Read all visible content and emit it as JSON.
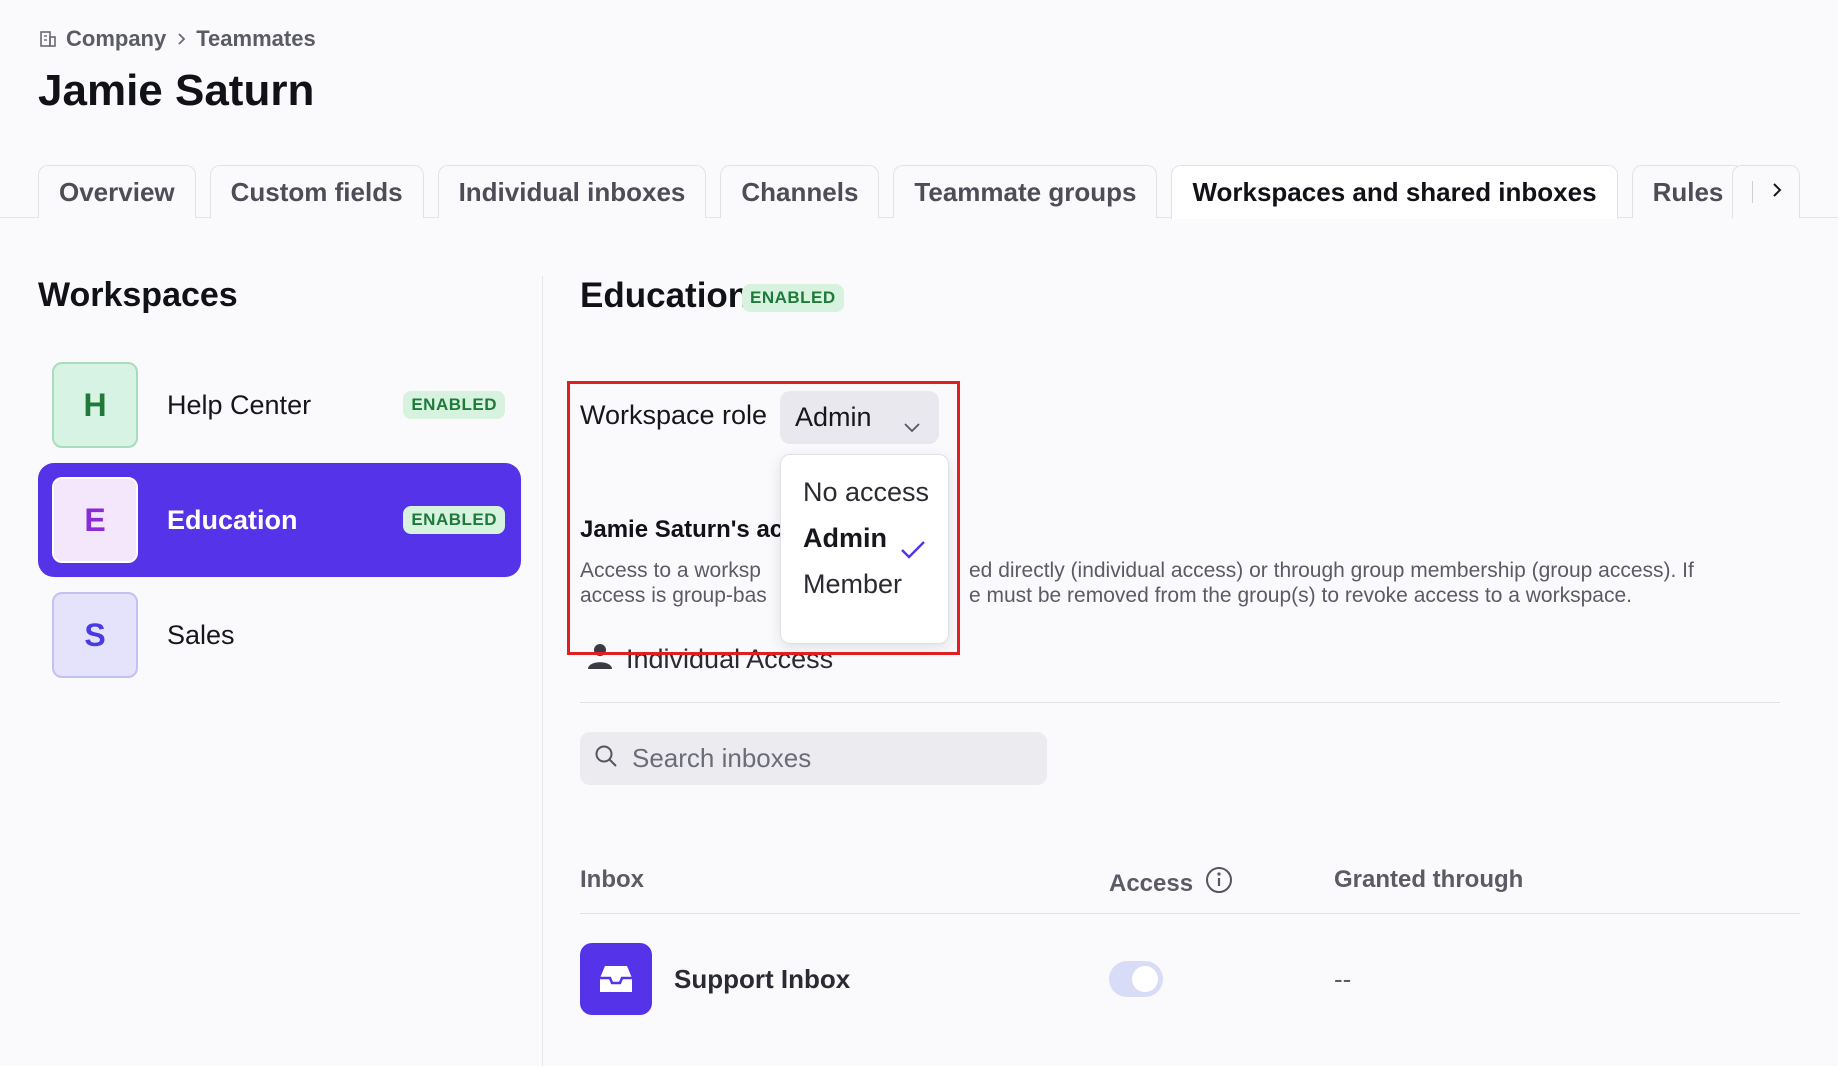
{
  "breadcrumb": {
    "company": "Company",
    "teammates": "Teammates"
  },
  "page_title": "Jamie Saturn",
  "tabs": [
    {
      "label": "Overview"
    },
    {
      "label": "Custom fields"
    },
    {
      "label": "Individual inboxes"
    },
    {
      "label": "Channels"
    },
    {
      "label": "Teammate groups"
    },
    {
      "label": "Workspaces and shared inboxes"
    },
    {
      "label": "Rules"
    }
  ],
  "workspaces": {
    "heading": "Workspaces",
    "items": [
      {
        "initial": "H",
        "name": "Help Center",
        "badge": "ENABLED",
        "avatar_bg": "#d7f3e3",
        "avatar_fg": "#1f7a3a"
      },
      {
        "initial": "E",
        "name": "Education",
        "badge": "ENABLED",
        "avatar_bg": "#f4e6fb",
        "avatar_fg": "#8a2bd6"
      },
      {
        "initial": "S",
        "name": "Sales",
        "badge": "",
        "avatar_bg": "#e4e3fb",
        "avatar_fg": "#4a3be0"
      }
    ]
  },
  "detail": {
    "title": "Education",
    "badge": "ENABLED",
    "role_label": "Workspace role",
    "role_value": "Admin",
    "access_heading": "Jamie Saturn's ac",
    "access_desc_line1_a": "Access to a worksp",
    "access_desc_line1_b": "ed directly (individual access) or through group membership (group access). If",
    "access_desc_line2_a": "access is group-bas",
    "access_desc_line2_b": "e must be removed from the group(s) to revoke access to a workspace.",
    "individual_access": "Individual Access",
    "search_placeholder": "Search inboxes"
  },
  "role_dropdown": {
    "options": [
      "No access",
      "Admin",
      "Member"
    ],
    "selected": "Admin"
  },
  "table": {
    "headers": {
      "inbox": "Inbox",
      "access": "Access",
      "granted": "Granted through"
    },
    "rows": [
      {
        "inbox": "Support Inbox",
        "access": true,
        "granted": "--"
      }
    ]
  },
  "colors": {
    "accent": "#5533e8",
    "enabled_bg": "#d7f3df",
    "enabled_fg": "#1f7a3a",
    "highlight": "#e02020"
  }
}
